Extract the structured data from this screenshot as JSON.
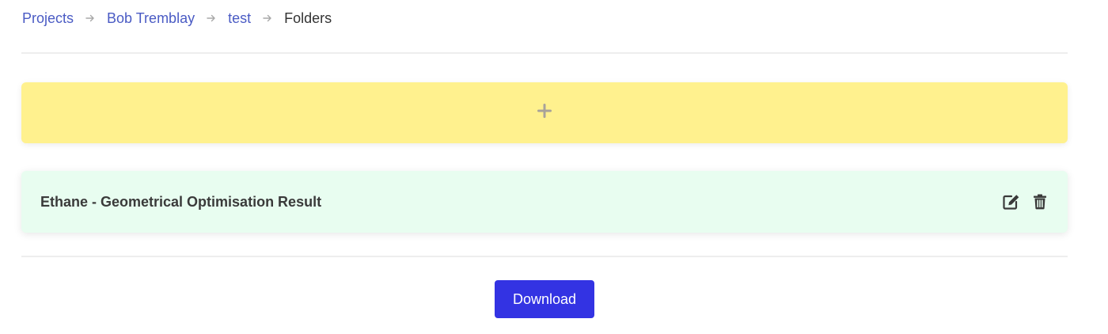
{
  "breadcrumb": {
    "items": [
      {
        "label": "Projects"
      },
      {
        "label": "Bob Tremblay"
      },
      {
        "label": "test"
      },
      {
        "label": "Folders"
      }
    ],
    "separator_icon": "arrow-right-icon"
  },
  "add_folder": {
    "icon": "plus-icon"
  },
  "folders": [
    {
      "title": "Ethane - Geometrical Optimisation Result",
      "edit_icon": "edit-icon",
      "delete_icon": "trash-icon"
    }
  ],
  "actions": {
    "download_label": "Download"
  },
  "colors": {
    "link": "#4a5bc4",
    "add_bar_bg": "#fff18e",
    "folder_card_bg": "#e8fdf0",
    "primary_button": "#3333e3"
  }
}
